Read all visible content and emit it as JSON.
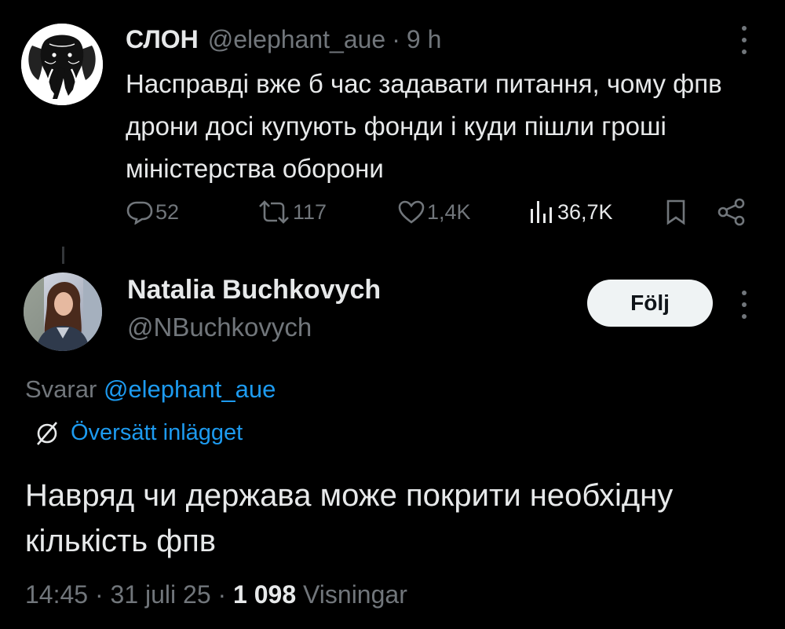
{
  "parent_tweet": {
    "author_name": "СЛОН",
    "handle": "@elephant_aue",
    "separator": "·",
    "time": "9 h",
    "text": "Насправді вже б час задавати питання, чому фпв дрони досі купують фонди і куди пішли гроші міністерства оборони",
    "actions": {
      "replies": "52",
      "reposts": "117",
      "likes": "1,4K",
      "views": "36,7K"
    },
    "icons": [
      "elephant-avatar-icon",
      "more-icon",
      "reply-icon",
      "repost-icon",
      "like-icon",
      "views-icon",
      "bookmark-icon",
      "share-icon"
    ]
  },
  "reply_tweet": {
    "author_name": "Natalia Buchkovych",
    "handle": "@NBuchkovych",
    "follow_label": "Följ",
    "replying_prefix": "Svarar",
    "replying_mention": "@elephant_aue",
    "translate_label": "Översätt inlägget",
    "text": "Навряд чи держава може покрити необхідну кількість фпв",
    "time": "14:45",
    "date": "31 juli 25",
    "separator": "·",
    "views_count": "1 098",
    "views_label": "Visningar"
  },
  "colors": {
    "background": "#000000",
    "text_primary": "#e7e9ea",
    "text_secondary": "#71767b",
    "accent": "#1d9bf0",
    "follow_bg": "#eff3f4"
  }
}
